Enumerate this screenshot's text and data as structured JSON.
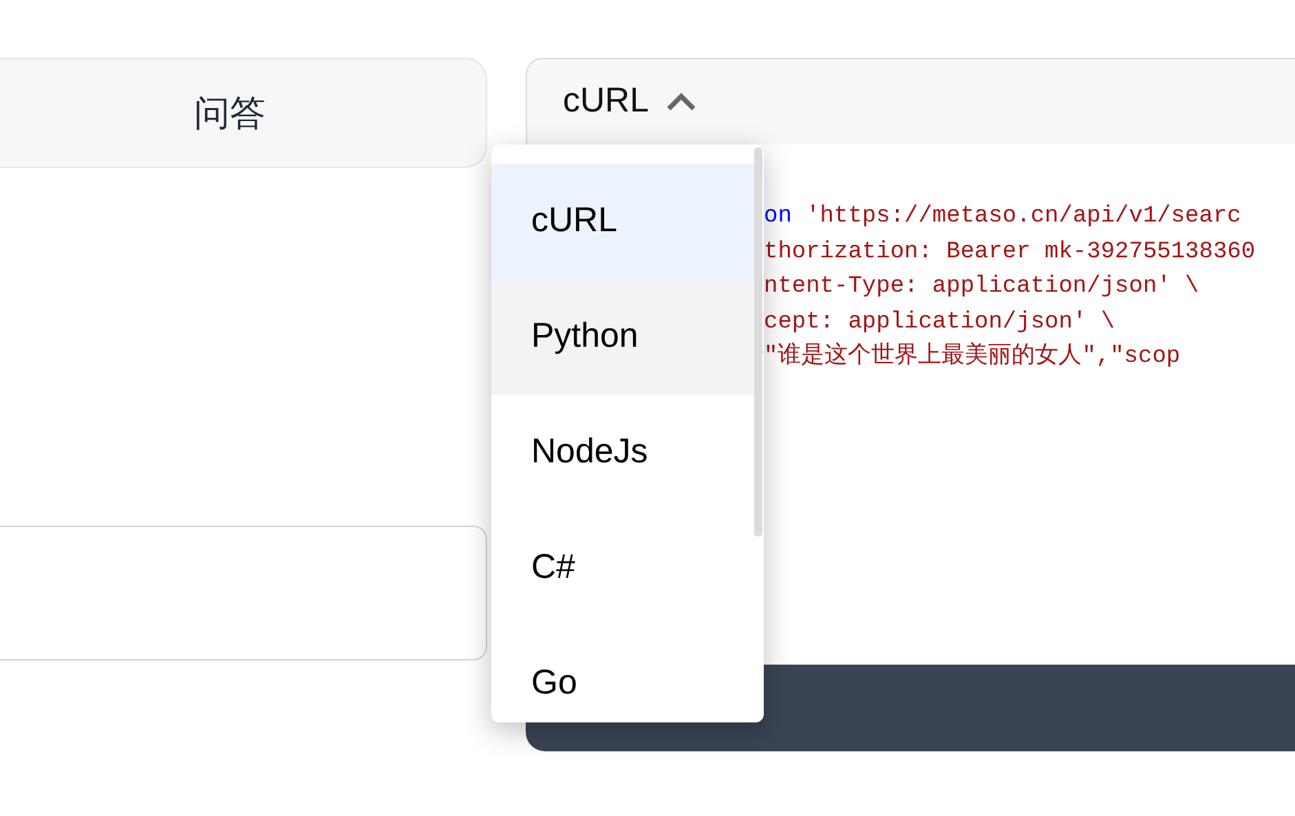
{
  "mode_tab": {
    "label": "问答"
  },
  "language_select": {
    "value": "cURL",
    "expanded": true,
    "options": [
      {
        "label": "cURL",
        "selected": true,
        "hovered": false
      },
      {
        "label": "Python",
        "selected": false,
        "hovered": true
      },
      {
        "label": "NodeJs",
        "selected": false,
        "hovered": false
      },
      {
        "label": "C#",
        "selected": false,
        "hovered": false
      },
      {
        "label": "Go",
        "selected": false,
        "hovered": false
      }
    ]
  },
  "code_lines": [
    [
      {
        "kind": "keyword",
        "text": "on"
      },
      {
        "kind": "string",
        "text": " 'https://metaso.cn/api/v1/searc"
      }
    ],
    [
      {
        "kind": "string",
        "text": "thorization: Bearer mk-392755138360"
      }
    ],
    [
      {
        "kind": "string",
        "text": "ntent-Type: application/json' \\"
      }
    ],
    [
      {
        "kind": "string",
        "text": "cept: application/json' \\"
      }
    ],
    [
      {
        "kind": "string",
        "text": "\"谁是这个世界上最美丽的女人\",\"scop"
      }
    ]
  ]
}
